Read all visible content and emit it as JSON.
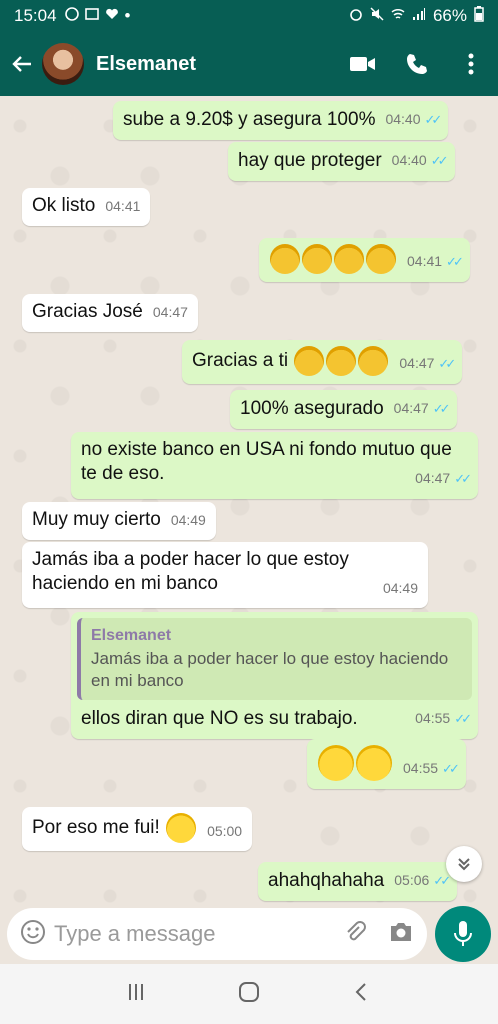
{
  "status": {
    "time": "15:04",
    "battery": "66%"
  },
  "header": {
    "contact_name": "Elsemanet"
  },
  "messages": [
    {
      "text": "sube a 9.20$ y asegura 100%",
      "time": "04:40"
    },
    {
      "text": "hay que proteger",
      "time": "04:40"
    },
    {
      "text": "Ok listo",
      "time": "04:41"
    },
    {
      "text": "",
      "time": "04:41"
    },
    {
      "text": "Gracias José",
      "time": "04:47"
    },
    {
      "text": "Gracias a ti",
      "time": "04:47"
    },
    {
      "text": "100% asegurado",
      "time": "04:47"
    },
    {
      "text": "no existe banco en USA ni fondo mutuo que te de eso.",
      "time": "04:47"
    },
    {
      "text": "Muy muy cierto",
      "time": "04:49"
    },
    {
      "text": "Jamás iba a poder hacer lo que estoy haciendo en mi banco",
      "time": "04:49"
    },
    {
      "quote_name": "Elsemanet",
      "quote_text": "Jamás iba a poder hacer lo que estoy haciendo en mi banco",
      "text": "ellos diran que NO es su trabajo.",
      "time": "04:55"
    },
    {
      "text": "",
      "time": "04:55"
    },
    {
      "text": "Por eso me fui!",
      "time": "05:00"
    },
    {
      "text": "ahahqhahaha",
      "time": "05:06"
    }
  ],
  "composer": {
    "placeholder": "Type a message"
  }
}
